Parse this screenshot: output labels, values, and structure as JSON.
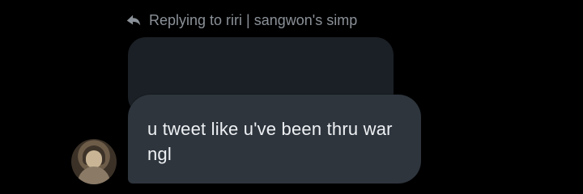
{
  "reply_header": {
    "text": "Replying to riri | sangwon's simp",
    "icon": "reply-arrow-icon"
  },
  "message": {
    "text": "u tweet like u've been thru war ngl"
  },
  "avatar": {
    "icon": "user-avatar"
  },
  "colors": {
    "background": "#000000",
    "bubble": "#2e353d",
    "quoted_bubble": "#1b2026",
    "text": "#eef1f4",
    "muted_text": "#8b9198"
  }
}
